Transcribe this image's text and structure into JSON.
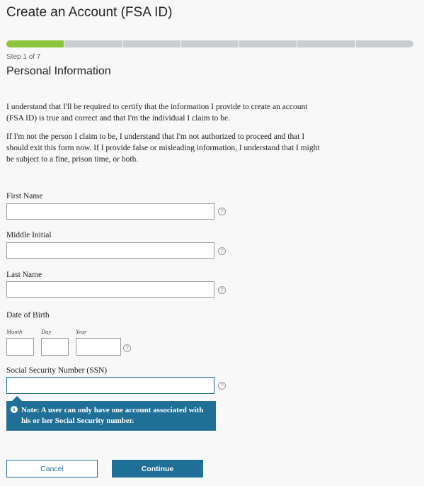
{
  "page": {
    "title": "Create an Account (FSA ID)",
    "step": "Step 1 of 7",
    "section": "Personal Information",
    "progress": {
      "total_steps": 7,
      "current_step": 1
    }
  },
  "intro": {
    "para1": "I understand that I'll be required to certify that the information I provide to create an account (FSA ID) is true and correct and that I'm the individual I claim to be.",
    "para2": "If I'm not the person I claim to be, I understand that I'm not authorized to proceed and that I should exit this form now. If I provide false or misleading information, I understand that I might be subject to a fine, prison time, or both."
  },
  "form": {
    "first_name": {
      "label": "First Name",
      "value": ""
    },
    "middle_initial": {
      "label": "Middle Initial",
      "value": ""
    },
    "last_name": {
      "label": "Last Name",
      "value": ""
    },
    "dob": {
      "label": "Date of Birth",
      "month_label": "Month",
      "day_label": "Day",
      "year_label": "Year"
    },
    "ssn": {
      "label": "Social Security Number (SSN)",
      "value": ""
    },
    "help_glyph": "?"
  },
  "note": {
    "icon": "info-icon",
    "icon_glyph": "i",
    "text": "Note: A user can only have one account associated with his or her Social Security number."
  },
  "buttons": {
    "cancel": "Cancel",
    "continue": "Continue"
  },
  "colors": {
    "progress_done": "#8cc43c",
    "progress_todo": "#c9cdcf",
    "accent": "#1f6f96"
  }
}
